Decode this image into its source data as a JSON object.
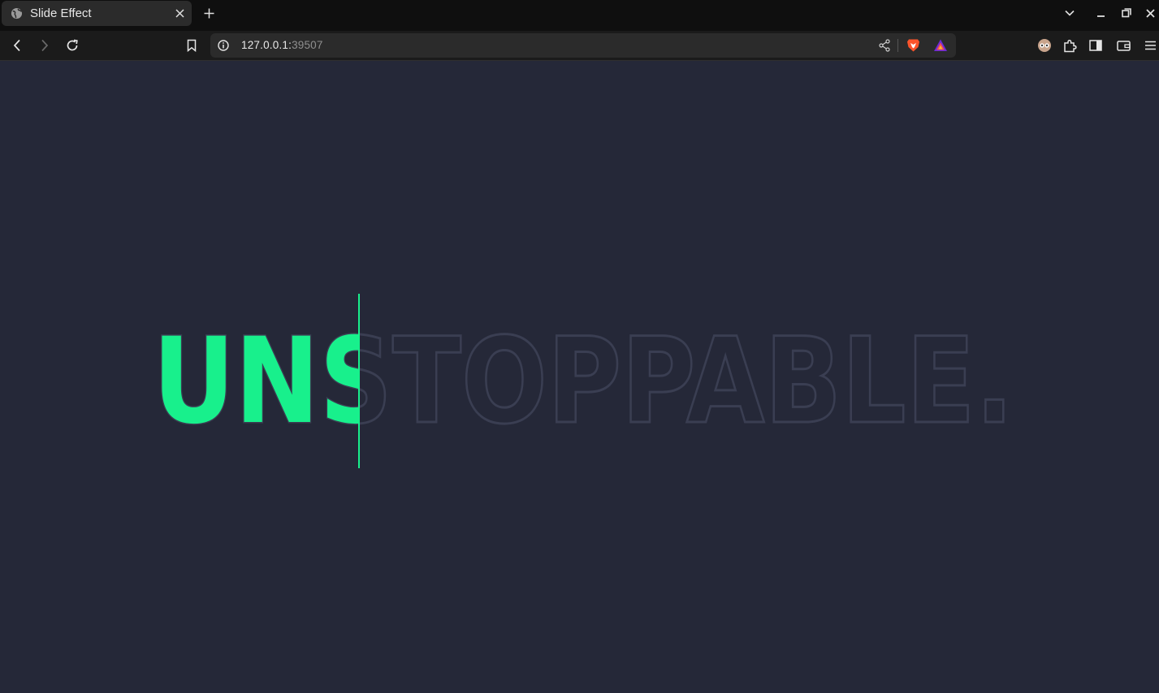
{
  "browser": {
    "tab_title": "Slide Effect",
    "url_host": "127.0.0.1:",
    "url_port": "39507"
  },
  "hero": {
    "word": "UNSTOPPABLE.",
    "revealed_fraction": 0.24
  },
  "colors": {
    "background": "#252838",
    "accent": "#18f08c",
    "outline": "#3a3e52"
  },
  "icons": [
    "globe-icon",
    "close-icon",
    "plus-icon",
    "chevron-down-icon",
    "minimize-icon",
    "restore-icon",
    "window-close-icon",
    "back-icon",
    "forward-icon",
    "reload-icon",
    "bookmark-icon",
    "info-icon",
    "share-icon",
    "brave-shield-icon",
    "brave-rewards-icon",
    "leo-icon",
    "extensions-icon",
    "sidebar-icon",
    "wallet-icon",
    "menu-icon"
  ]
}
